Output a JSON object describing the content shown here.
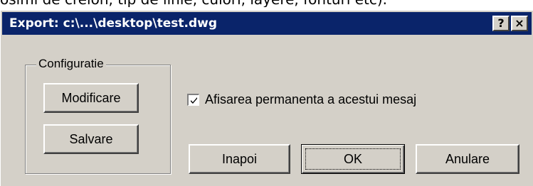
{
  "background_snippet": "osimi de creion, tip de linie, culori, layere, fonturi etc).",
  "window": {
    "title": "Export: c:\\...\\desktop\\test.dwg",
    "help_glyph": "?",
    "close_glyph": "×",
    "titlebar_color": "#0a246a",
    "face_color": "#d4d0c8"
  },
  "config_group": {
    "label": "Configuratie",
    "modify_label": "Modificare",
    "save_label": "Salvare"
  },
  "checkbox": {
    "label": "Afisarea permanenta a acestui mesaj",
    "checked": true
  },
  "buttons": {
    "back_label": "Inapoi",
    "ok_label": "OK",
    "cancel_label": "Anulare"
  }
}
